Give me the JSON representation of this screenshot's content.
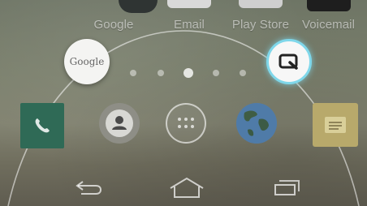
{
  "dock": {
    "items": [
      {
        "label": "Google",
        "stub_color": "#3a3f3c"
      },
      {
        "label": "Email",
        "stub_color": "#d9d9d9"
      },
      {
        "label": "Play Store",
        "stub_color": "#d0d0d0"
      },
      {
        "label": "Voicemail",
        "stub_color": "#1e1e1e"
      }
    ]
  },
  "shortcuts": {
    "google": {
      "label": "Google"
    },
    "qslide": {
      "icon": "qslide-icon",
      "accent": "#7fd7ea"
    }
  },
  "pages": {
    "count": 5,
    "active_index": 2
  },
  "apps": [
    {
      "name": "phone",
      "icon": "phone-icon"
    },
    {
      "name": "contacts",
      "icon": "contact-icon"
    },
    {
      "name": "apps",
      "icon": "app-drawer-icon"
    },
    {
      "name": "browser",
      "icon": "globe-icon"
    },
    {
      "name": "memo",
      "icon": "notes-icon"
    }
  ],
  "navbar": {
    "buttons": [
      "back",
      "home",
      "recent-apps"
    ]
  }
}
